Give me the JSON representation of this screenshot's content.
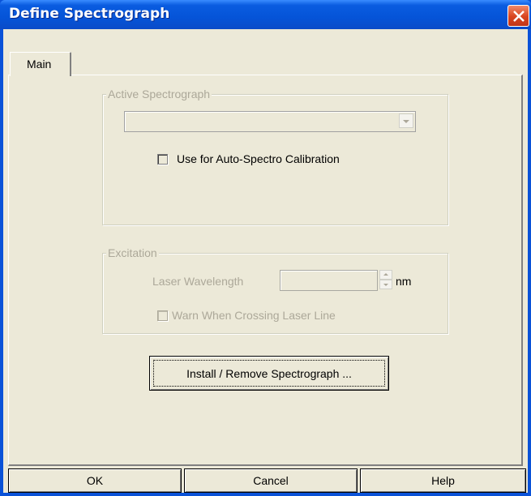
{
  "window": {
    "title": "Define Spectrograph"
  },
  "tabs": [
    {
      "label": "Main"
    }
  ],
  "active_spectrograph": {
    "legend": "Active Spectrograph",
    "selected": "",
    "auto_calib_label": "Use for Auto-Spectro Calibration",
    "auto_calib_checked": false
  },
  "excitation": {
    "legend": "Excitation",
    "laser_label": "Laser Wavelength",
    "laser_value": "",
    "unit": "nm",
    "warn_label": "Warn When Crossing Laser Line",
    "warn_checked": false
  },
  "install_button": "Install / Remove Spectrograph ...",
  "footer": {
    "ok": "OK",
    "cancel": "Cancel",
    "help": "Help"
  }
}
